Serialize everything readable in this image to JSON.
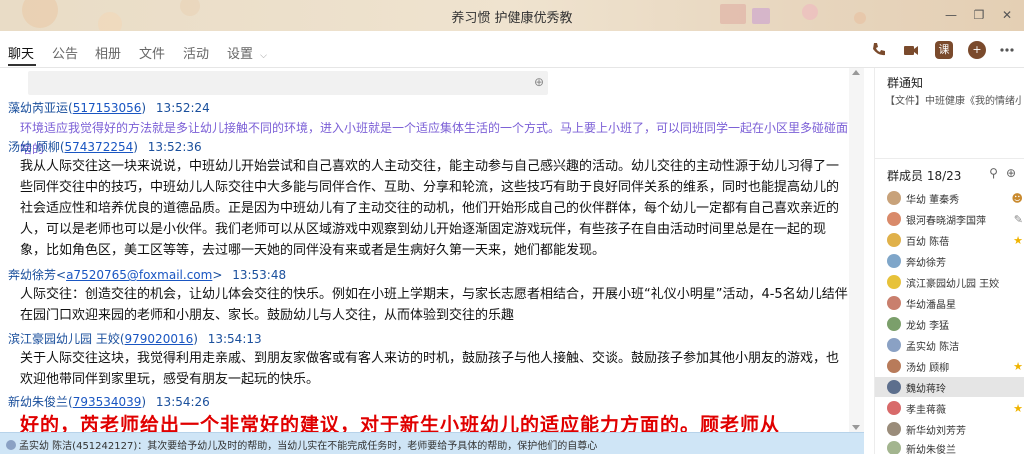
{
  "window": {
    "title": "养习惯 护健康优秀教",
    "controls": [
      "—",
      "❐",
      "✕"
    ]
  },
  "tabs": [
    {
      "label": "聊天",
      "active": true
    },
    {
      "label": "公告",
      "active": false
    },
    {
      "label": "相册",
      "active": false
    },
    {
      "label": "文件",
      "active": false
    },
    {
      "label": "活动",
      "active": false
    },
    {
      "label": "设置",
      "active": false
    }
  ],
  "toolbar": {
    "course_label": "课"
  },
  "messages": [
    {
      "sender": "藻幼芮亚运",
      "id": "517153056",
      "time": "13:52:24",
      "text": "环境适应我觉得好的方法就是多让幼儿接触不同的环境，进入小班就是一个适应集体生活的一个方式。马上要上小班了，可以同班同学一起在小区里多碰碰面啥的",
      "style": "purple"
    },
    {
      "sender": "汤幼 顾柳",
      "id": "574372254",
      "time": "13:52:36",
      "text": "我从人际交往这一块来说说，中班幼儿开始尝试和自己喜欢的人主动交往，能主动参与自己感兴趣的活动。幼儿交往的主动性源于幼儿习得了一些同伴交往中的技巧，中班幼儿人际交往中大多能与同伴合作、互助、分享和轮流，这些技巧有助于良好同伴关系的维系，同时也能提高幼儿的社会适应性和培养优良的道德品质。正是因为中班幼儿有了主动交往的动机，他们开始形成自己的伙伴群体，每个幼儿一定都有自己喜欢亲近的人，可以是老师也可以是小伙伴。我们老师可以从区域游戏中观察到幼儿开始逐渐固定游戏玩伴，有些孩子在自由活动时间里总是在一起的现象，比如角色区，美工区等等，去过哪一天她的同伴没有来或者是生病好久第一天来，她们都能发现。",
      "style": "normal"
    },
    {
      "sender": "奔幼徐芳",
      "id": "a7520765@foxmail.com",
      "id_wrap": "angle",
      "time": "13:53:48",
      "text": "人际交往：创造交往的机会，让幼儿体会交往的快乐。例如在小班上学期末，与家长志愿者相结合，开展小班“礼仪小明星”活动，4-5名幼儿结伴在园门口欢迎来园的老师和小朋友、家长。鼓励幼儿与人交往，从而体验到交往的乐趣",
      "style": "normal"
    },
    {
      "sender": "滨江豪园幼儿园 王姣",
      "id": "979020016",
      "time": "13:54:13",
      "text": "关于人际交往这块，我觉得利用走亲戚、到朋友家做客或有客人来访的时机，鼓励孩子与他人接触、交谈。鼓励孩子参加其他小朋友的游戏，也欢迎他带同伴到家里玩，感受有朋友一起玩的快乐。",
      "style": "normal"
    },
    {
      "sender": "新幼朱俊兰",
      "id": "793534039",
      "time": "13:54:26",
      "text": "好的，芮老师给出一个非常好的建议，对于新生小班幼儿的适应能力方面的。顾老师从",
      "style": "big"
    }
  ],
  "notice_bar": {
    "text": "孟实幼 陈洁(451242127)：其次要给予幼儿及时的帮助，当幼儿实在不能完成任务时，老师要给予具体的帮助，保护他们的自尊心"
  },
  "right_panel": {
    "notice_title": "群通知",
    "notice_text": "【文件】中班健康《我的情绪小...",
    "members_title": "群成员 18/23",
    "members": [
      {
        "name": "华幼 董秦秀",
        "color": "#c8a27a",
        "badge": "person-icon"
      },
      {
        "name": "银河春晓湖李国萍",
        "color": "#d98a6a",
        "badge": "edit-icon"
      },
      {
        "name": "百幼 陈蓓",
        "color": "#e0b14a",
        "badge": "star-icon"
      },
      {
        "name": "奔幼徐芳",
        "color": "#7fa6c9",
        "badge": ""
      },
      {
        "name": "滨江豪园幼儿园 王姣",
        "color": "#e7c23a",
        "badge": ""
      },
      {
        "name": "华幼潘晶星",
        "color": "#c97f6d",
        "badge": ""
      },
      {
        "name": "龙幼 李猛",
        "color": "#7b9f6b",
        "badge": ""
      },
      {
        "name": "孟实幼 陈洁",
        "color": "#8aa1c4",
        "badge": ""
      },
      {
        "name": "汤幼 顾柳",
        "color": "#b87b5a",
        "badge": "star-icon"
      },
      {
        "name": "魏幼蒋玲",
        "color": "#5d6f8d",
        "badge": "",
        "selected": true
      },
      {
        "name": "孝圭蒋薇",
        "color": "#d86a6a",
        "badge": "star-icon"
      },
      {
        "name": "新华幼刘芳芳",
        "color": "#9a8c7a",
        "badge": ""
      },
      {
        "name": "新幼朱俊兰",
        "color": "#a3b58f",
        "badge": ""
      }
    ]
  }
}
